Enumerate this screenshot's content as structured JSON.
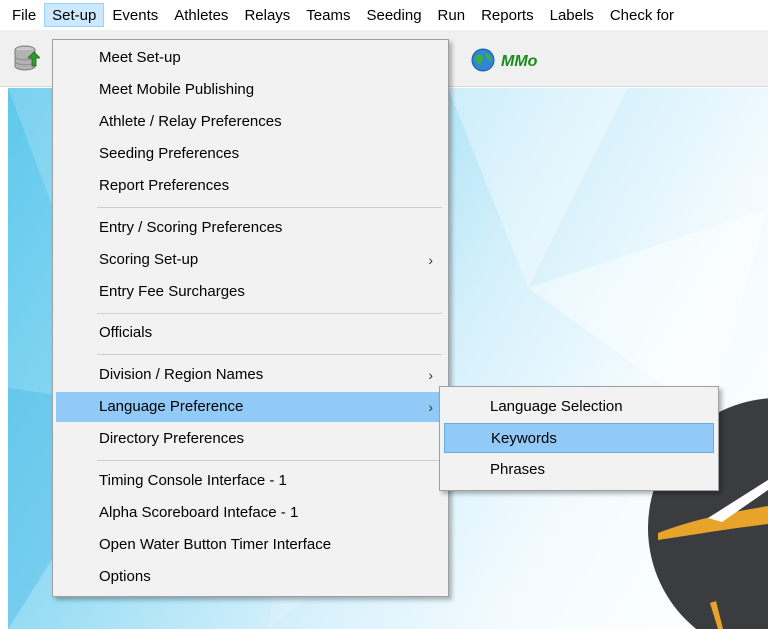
{
  "menubar": {
    "items": [
      {
        "label": "File"
      },
      {
        "label": "Set-up"
      },
      {
        "label": "Events"
      },
      {
        "label": "Athletes"
      },
      {
        "label": "Relays"
      },
      {
        "label": "Teams"
      },
      {
        "label": "Seeding"
      },
      {
        "label": "Run"
      },
      {
        "label": "Reports"
      },
      {
        "label": "Labels"
      },
      {
        "label": "Check for"
      }
    ],
    "active": "Set-up"
  },
  "toolbar": {
    "database_icon": "database-upload-icon",
    "mmo_icon": "globe-icon",
    "mmo_label": "MMo"
  },
  "setup_menu": {
    "items": [
      {
        "label": "Meet Set-up"
      },
      {
        "label": "Meet Mobile Publishing"
      },
      {
        "label": "Athlete / Relay Preferences"
      },
      {
        "label": "Seeding Preferences"
      },
      {
        "label": "Report Preferences"
      },
      {
        "label": "Entry / Scoring Preferences"
      },
      {
        "label": "Scoring Set-up",
        "arrow": "›"
      },
      {
        "label": "Entry Fee Surcharges"
      },
      {
        "label": "Officials"
      },
      {
        "label": "Division / Region Names",
        "arrow": "›"
      },
      {
        "label": "Language Preference",
        "arrow": "›"
      },
      {
        "label": "Directory Preferences"
      },
      {
        "label": "Timing Console Interface - 1"
      },
      {
        "label": "Alpha Scoreboard Inteface - 1"
      },
      {
        "label": "Open Water Button Timer Interface"
      },
      {
        "label": "Options"
      }
    ],
    "highlighted": "Language Preference"
  },
  "language_submenu": {
    "items": [
      {
        "label": "Language Selection"
      },
      {
        "label": "Keywords"
      },
      {
        "label": "Phrases"
      }
    ],
    "highlighted": "Keywords"
  },
  "colors": {
    "menu_highlight": "#91c9f7",
    "menubar_active": "#cce8ff",
    "mmo_text": "#1a8a1a"
  }
}
